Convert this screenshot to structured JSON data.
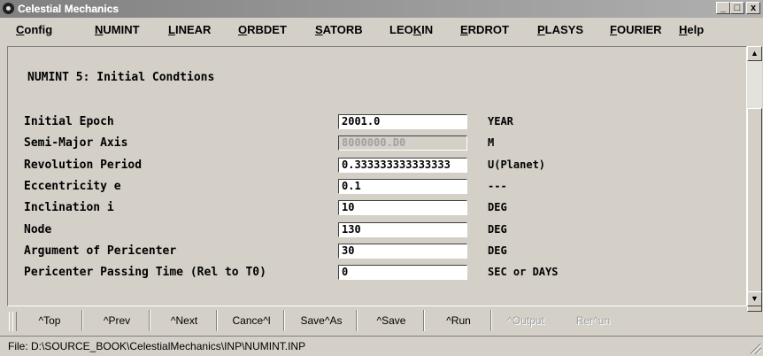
{
  "window": {
    "title": "Celestial Mechanics",
    "minimize": "_",
    "restore": "□",
    "close": "x"
  },
  "menu": [
    {
      "label": "Config",
      "underline": "C",
      "rest": "onfig"
    },
    {
      "label": "NUMINT",
      "underline": "N",
      "rest": "UMINT"
    },
    {
      "label": "LINEAR",
      "underline": "L",
      "rest": "INEAR"
    },
    {
      "label": "ORBDET",
      "underline": "O",
      "rest": "RBDET"
    },
    {
      "label": "SATORB",
      "underline": "S",
      "rest": "ATORB"
    },
    {
      "label": "LEOKIN",
      "pre": "LEO",
      "underline": "K",
      "rest": "IN"
    },
    {
      "label": "ERDROT",
      "underline": "E",
      "rest": "RDROT"
    },
    {
      "label": "PLASYS",
      "underline": "P",
      "rest": "LASYS"
    },
    {
      "label": "FOURIER",
      "underline": "F",
      "rest": "OURIER"
    },
    {
      "label": "Help",
      "underline": "H",
      "rest": "elp"
    }
  ],
  "form": {
    "title": "NUMINT 5: Initial Condtions",
    "rows": [
      {
        "label": "Initial Epoch",
        "value": "2001.0",
        "unit": "YEAR",
        "disabled": false
      },
      {
        "label": "Semi-Major Axis",
        "value": "8000000.D0",
        "unit": "M",
        "disabled": true
      },
      {
        "label": "Revolution Period",
        "value": "0.333333333333333",
        "unit": "U(Planet)",
        "disabled": false
      },
      {
        "label": "Eccentricity e",
        "value": "0.1",
        "unit": "---",
        "disabled": false
      },
      {
        "label": "Inclination i",
        "value": "10",
        "unit": "DEG",
        "disabled": false
      },
      {
        "label": "Node",
        "value": "130",
        "unit": "DEG",
        "disabled": false
      },
      {
        "label": "Argument of Pericenter",
        "value": "30",
        "unit": "DEG",
        "disabled": false
      },
      {
        "label": "Pericenter Passing Time (Rel to T0)",
        "value": "0",
        "unit": "SEC or DAYS",
        "disabled": false
      }
    ]
  },
  "toolbar": [
    {
      "label": "^Top",
      "enabled": true
    },
    {
      "label": "^Prev",
      "enabled": true
    },
    {
      "label": "^Next",
      "enabled": true
    },
    {
      "label": "Cance^l",
      "enabled": true
    },
    {
      "label": "Save^As",
      "enabled": true
    },
    {
      "label": "^Save",
      "enabled": true
    },
    {
      "label": "^Run",
      "enabled": true
    },
    {
      "label": "^Output",
      "enabled": false
    },
    {
      "label": "Rer^un",
      "enabled": false
    }
  ],
  "status": {
    "text": "File: D:\\SOURCE_BOOK\\CelestialMechanics\\INP\\NUMINT.INP"
  },
  "scroll": {
    "up": "▲",
    "down": "▼"
  }
}
